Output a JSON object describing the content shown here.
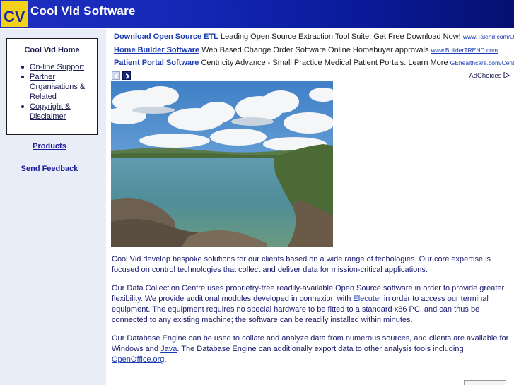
{
  "header": {
    "logo_text": "CV",
    "title": "Cool Vid Software"
  },
  "nav": {
    "box_title": "Cool Vid Home",
    "items": [
      {
        "label": "On-line Support"
      },
      {
        "label": "Partner Organisations & Related"
      },
      {
        "label": "Copyright & Disclaimer"
      }
    ],
    "products": "Products",
    "send_feedback": "Send Feedback"
  },
  "ads": [
    {
      "title": "Download Open Source ETL",
      "text": "Leading Open Source Extraction Tool Suite. Get Free Download Now!",
      "url": "www.Talend.com/Open_Sou"
    },
    {
      "title": "Home Builder Software",
      "text": "Web Based Change Order Software Online Homebuyer approvals",
      "url": "www.BuilderTREND.com"
    },
    {
      "title": "Patient Portal Software",
      "text": "Centricity Advance - Small Practice Medical Patient Portals. Learn More",
      "url": "GEhealthcare.com/CentricityAdva"
    }
  ],
  "adchoices": "AdChoices",
  "content": {
    "p1": "Cool Vid develop bespoke solutions for our clients based on a wide range of techologies.  Our core expertise is focused on control technologies that collect and deliver data for mission-critical applications.",
    "p2_a": "Our Data Collection Centre uses proprietry-free readily-available Open Source software in order to provide greater flexibility.  We provide additional modules developed in connexion with ",
    "p2_link": "Elecuter",
    "p2_b": " in order to access our terminal equipment.  The equipment requires no special hardware to be fitted to a standard x86 PC, and can thus be connected to any existing machine; the software can be readily installed within minutes.",
    "p3_a": "Our Database Engine can be used to collate and analyze data from numerous sources, and clients are available for Windows and ",
    "p3_link1": "Java",
    "p3_b": ".  The Database Engine can additionally export data to other analysis tools including ",
    "p3_link2": "OpenOffice.org",
    "p3_c": "."
  },
  "colors": {
    "header_bg": "#1428b6",
    "logo_bg": "#f2d21a",
    "link": "#1a3ab0",
    "sidebar_bg": "#e9edf7"
  }
}
